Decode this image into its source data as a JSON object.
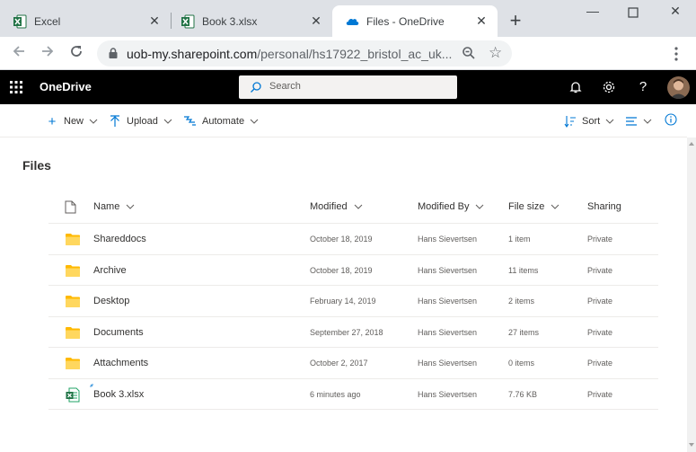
{
  "browser": {
    "tabs": [
      {
        "title": "Excel",
        "icon": "excel-icon",
        "active": false
      },
      {
        "title": "Book 3.xlsx",
        "icon": "excel-icon",
        "active": false
      },
      {
        "title": "Files - OneDrive",
        "icon": "onedrive-icon",
        "active": true
      }
    ],
    "address": {
      "domain": "uob-my.sharepoint.com",
      "path": "/personal/hs17922_bristol_ac_uk..."
    }
  },
  "suite": {
    "brand": "OneDrive",
    "search_placeholder": "Search"
  },
  "commands": {
    "new": "New",
    "upload": "Upload",
    "automate": "Automate",
    "sort": "Sort"
  },
  "page": {
    "title": "Files"
  },
  "columns": {
    "name": "Name",
    "modified": "Modified",
    "modified_by": "Modified By",
    "file_size": "File size",
    "sharing": "Sharing"
  },
  "files": [
    {
      "type": "folder",
      "name": "Shareddocs",
      "modified": "October 18, 2019",
      "modified_by": "Hans Sievertsen",
      "size": "1 item",
      "sharing": "Private"
    },
    {
      "type": "folder",
      "name": "Archive",
      "modified": "October 18, 2019",
      "modified_by": "Hans Sievertsen",
      "size": "11 items",
      "sharing": "Private"
    },
    {
      "type": "folder",
      "name": "Desktop",
      "modified": "February 14, 2019",
      "modified_by": "Hans Sievertsen",
      "size": "2 items",
      "sharing": "Private"
    },
    {
      "type": "folder",
      "name": "Documents",
      "modified": "September 27, 2018",
      "modified_by": "Hans Sievertsen",
      "size": "27 items",
      "sharing": "Private"
    },
    {
      "type": "folder",
      "name": "Attachments",
      "modified": "October 2, 2017",
      "modified_by": "Hans Sievertsen",
      "size": "0 items",
      "sharing": "Private"
    },
    {
      "type": "xlsx",
      "name": "Book 3.xlsx",
      "modified": "6 minutes ago",
      "modified_by": "Hans Sievertsen",
      "size": "7.76 KB",
      "sharing": "Private"
    }
  ],
  "colors": {
    "accent": "#0078d4",
    "suitebar": "#000000",
    "folder": "#ffb900",
    "excel": "#217346"
  }
}
